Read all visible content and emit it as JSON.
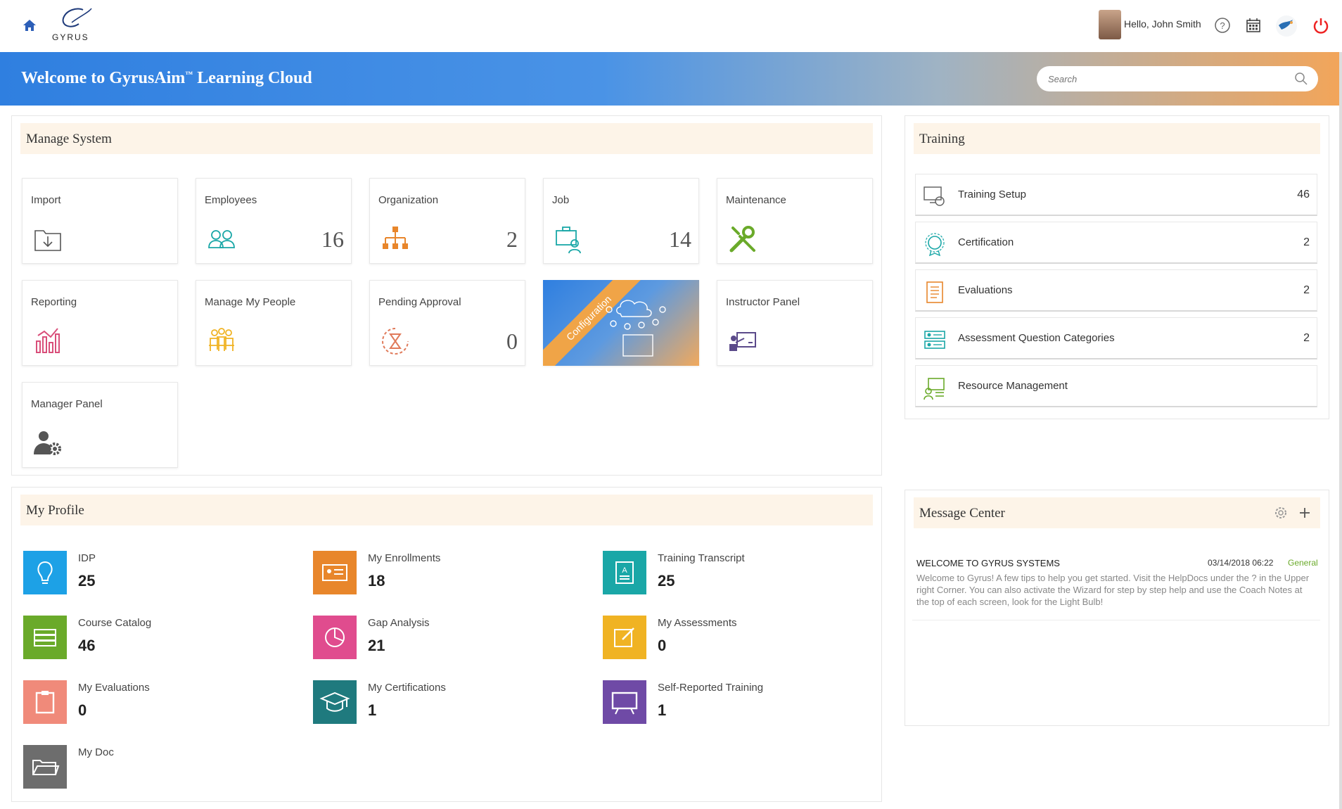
{
  "topbar": {
    "logo_text": "GYRUS",
    "greeting": "Hello, John Smith"
  },
  "banner": {
    "title": "Welcome to GyrusAim",
    "tm": "™",
    "title_suffix": " Learning Cloud",
    "search_placeholder": "Search"
  },
  "manage_system": {
    "title": "Manage System",
    "tiles": [
      {
        "label": "Import",
        "count": ""
      },
      {
        "label": "Employees",
        "count": "16"
      },
      {
        "label": "Organization",
        "count": "2"
      },
      {
        "label": "Job",
        "count": "14"
      },
      {
        "label": "Maintenance",
        "count": ""
      },
      {
        "label": "Reporting",
        "count": ""
      },
      {
        "label": "Manage My People",
        "count": ""
      },
      {
        "label": "Pending Approval",
        "count": "0"
      },
      {
        "label": "Configuration",
        "count": ""
      },
      {
        "label": "Instructor Panel",
        "count": ""
      },
      {
        "label": "Manager Panel",
        "count": ""
      }
    ]
  },
  "training": {
    "title": "Training",
    "items": [
      {
        "label": "Training Setup",
        "count": "46"
      },
      {
        "label": "Certification",
        "count": "2"
      },
      {
        "label": "Evaluations",
        "count": "2"
      },
      {
        "label": "Assessment Question Categories",
        "count": "2"
      },
      {
        "label": "Resource Management",
        "count": ""
      }
    ]
  },
  "my_profile": {
    "title": "My Profile",
    "items": [
      {
        "label": "IDP",
        "count": "25",
        "color": "#1da1e6"
      },
      {
        "label": "My Enrollments",
        "count": "18",
        "color": "#e8862b"
      },
      {
        "label": "Training Transcript",
        "count": "25",
        "color": "#1aa7a7"
      },
      {
        "label": "Course Catalog",
        "count": "46",
        "color": "#6aaa2a"
      },
      {
        "label": "Gap Analysis",
        "count": "21",
        "color": "#e04c8e"
      },
      {
        "label": "My Assessments",
        "count": "0",
        "color": "#f0b323"
      },
      {
        "label": "My Evaluations",
        "count": "0",
        "color": "#f08a7a"
      },
      {
        "label": "My Certifications",
        "count": "1",
        "color": "#1f7a7e"
      },
      {
        "label": "Self-Reported Training",
        "count": "1",
        "color": "#6f4aa6"
      },
      {
        "label": "My Doc",
        "count": "",
        "color": "#6d6d6d"
      }
    ]
  },
  "message_center": {
    "title": "Message Center",
    "message": {
      "title": "WELCOME TO GYRUS SYSTEMS",
      "date": "03/14/2018 06:22",
      "category": "General",
      "body": "Welcome to Gyrus! A few tips to help you get started. Visit the HelpDocs under the ? in the Upper right Corner. You can also activate the Wizard for step by step help and use the Coach Notes at the top of each screen, look for the Light Bulb!"
    }
  }
}
